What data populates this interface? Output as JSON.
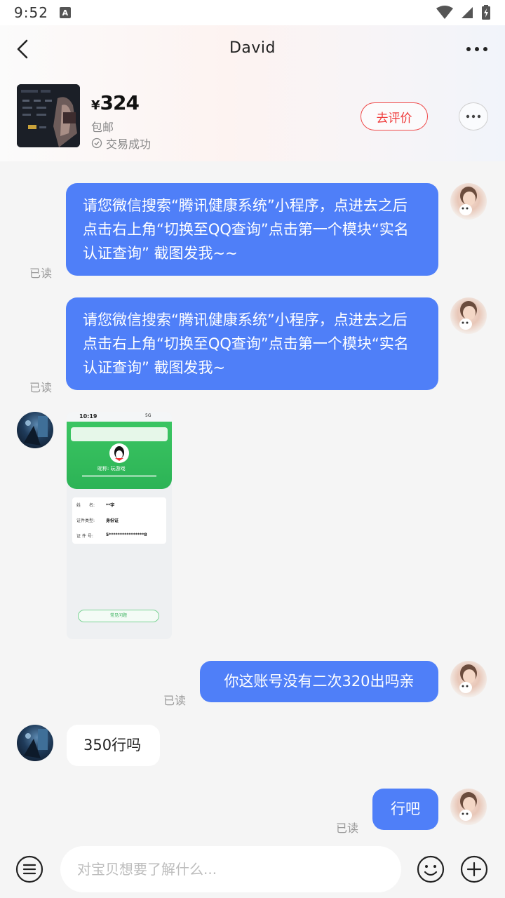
{
  "status_bar": {
    "time": "9:52",
    "notification_letter": "A"
  },
  "nav": {
    "title": "David"
  },
  "product": {
    "price_symbol": "¥",
    "price": "324",
    "shipping": "包邮",
    "status": "交易成功",
    "review_button": "去评价"
  },
  "messages": [
    {
      "sender": "me",
      "text": "请您微信搜索“腾讯健康系统”小程序，点进去之后点击右上角“切换至QQ查询”点击第一个模块“实名认证查询” 截图发我~~",
      "read": "已读"
    },
    {
      "sender": "me",
      "text": "请您微信搜索“腾讯健康系统”小程序，点进去之后点击右上角“切换至QQ查询”点击第一个模块“实名认证查询” 截图发我~",
      "read": "已读"
    },
    {
      "sender": "seller",
      "type": "image"
    },
    {
      "sender": "me",
      "text": "你这账号没有二次320出吗亲",
      "read": "已读"
    },
    {
      "sender": "seller",
      "text": "350行吗"
    },
    {
      "sender": "me",
      "text": "行吧",
      "read": "已读"
    }
  ],
  "screenshot_image": {
    "time": "10:19",
    "signal": "5G",
    "nickname": "昵称: 玩游戏",
    "row1_label": "姓　　名:",
    "row1_value": "**宇",
    "row2_label": "证件类型:",
    "row2_value": "身份证",
    "row3_label": "证 件 号:",
    "row3_value": "5****************8",
    "faq_button": "常见问题"
  },
  "input": {
    "placeholder": "对宝贝想要了解什么..."
  },
  "colors": {
    "bubble_me": "#4f7ff8",
    "review_red": "#ef3b3b",
    "app_green": "#34c45e"
  }
}
